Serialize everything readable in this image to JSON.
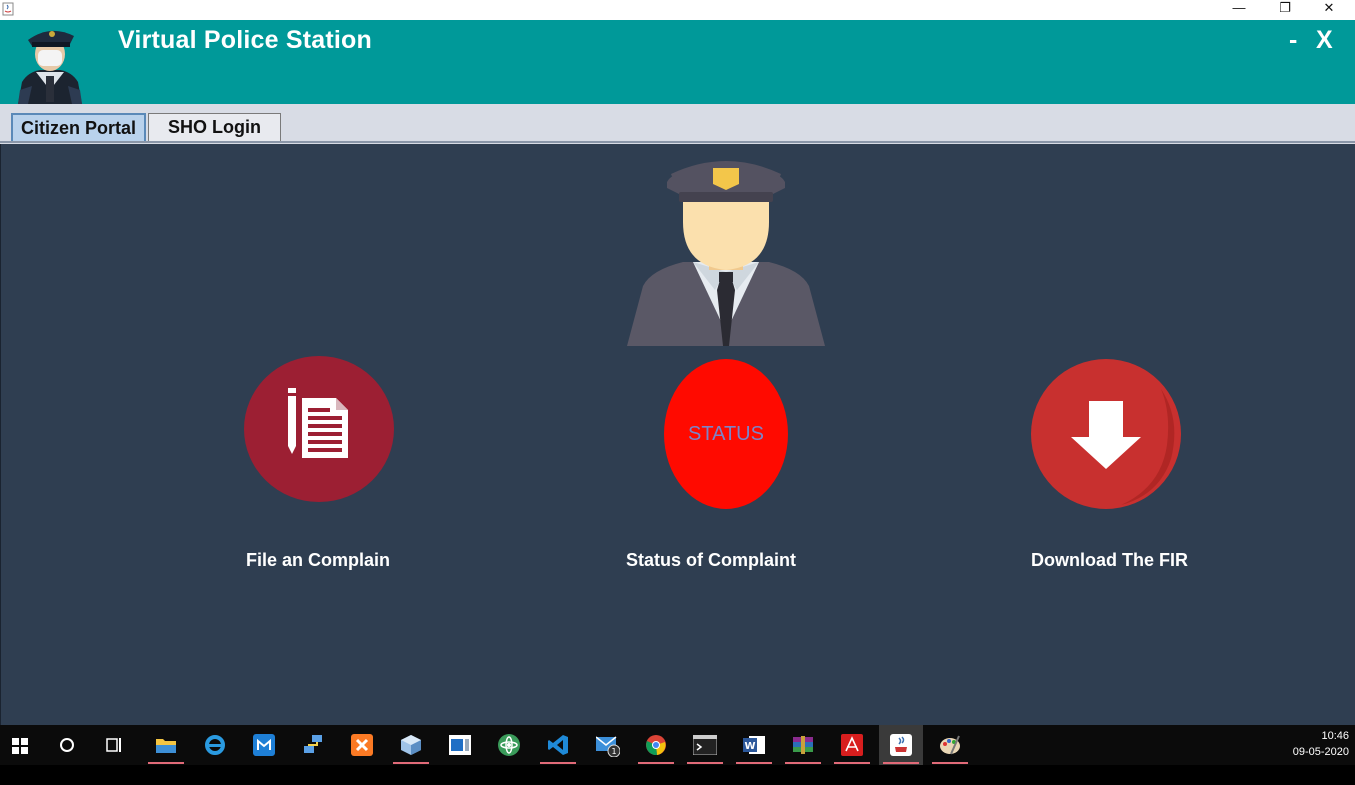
{
  "window": {
    "minimize_glyph": "—",
    "restore_glyph": "❐",
    "close_glyph": "✕"
  },
  "header": {
    "title": "Virtual Police Station",
    "minimize_label": "-",
    "close_label": "X"
  },
  "tabs": [
    {
      "label": "Citizen Portal",
      "selected": true
    },
    {
      "label": "SHO Login",
      "selected": false
    }
  ],
  "actions": {
    "file_complaint": {
      "label": "File an Complain",
      "icon": "document-icon",
      "color": "#9c1f33"
    },
    "status": {
      "label": "Status of Complaint",
      "badge_text": "STATUS",
      "color": "#ff0a00"
    },
    "download_fir": {
      "label": "Download The FIR",
      "icon": "download-arrow-icon",
      "color": "#c8302f"
    }
  },
  "colors": {
    "header_bg": "#009999",
    "panel_bg": "#2f3e51"
  },
  "taskbar": {
    "items": [
      {
        "name": "start",
        "icon": "windows-icon"
      },
      {
        "name": "search",
        "icon": "search-circle-icon"
      },
      {
        "name": "task-view",
        "icon": "task-view-icon"
      },
      {
        "name": "file-explorer",
        "icon": "folder-icon"
      },
      {
        "name": "internet-explorer",
        "icon": "ie-icon"
      },
      {
        "name": "app-blue",
        "icon": "app-window-icon"
      },
      {
        "name": "network-app",
        "icon": "network-icon"
      },
      {
        "name": "xampp",
        "icon": "xampp-icon"
      },
      {
        "name": "virtualbox",
        "icon": "cube-icon"
      },
      {
        "name": "window-app",
        "icon": "window-icon"
      },
      {
        "name": "atom",
        "icon": "atom-icon"
      },
      {
        "name": "vscode",
        "icon": "vscode-icon"
      },
      {
        "name": "mail",
        "icon": "mail-icon",
        "badge": "1"
      },
      {
        "name": "chrome",
        "icon": "chrome-icon"
      },
      {
        "name": "terminal",
        "icon": "terminal-icon"
      },
      {
        "name": "word",
        "icon": "word-icon"
      },
      {
        "name": "winrar",
        "icon": "winrar-icon"
      },
      {
        "name": "acrobat",
        "icon": "acrobat-icon"
      },
      {
        "name": "java",
        "icon": "java-icon"
      },
      {
        "name": "paint",
        "icon": "paint-palette-icon"
      }
    ],
    "time": "10:46",
    "date": "09-05-2020"
  }
}
